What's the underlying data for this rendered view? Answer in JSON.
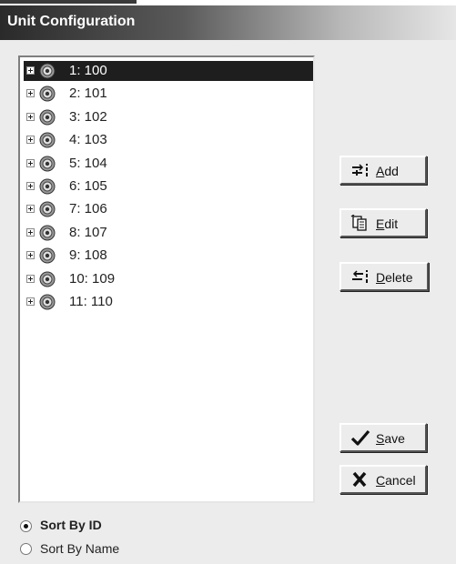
{
  "window": {
    "title": "Unit Configuration"
  },
  "tree": {
    "items": [
      {
        "label": "1: 100",
        "selected": true
      },
      {
        "label": "2: 101",
        "selected": false
      },
      {
        "label": "3: 102",
        "selected": false
      },
      {
        "label": "4: 103",
        "selected": false
      },
      {
        "label": "5: 104",
        "selected": false
      },
      {
        "label": "6: 105",
        "selected": false
      },
      {
        "label": "7: 106",
        "selected": false
      },
      {
        "label": "8: 107",
        "selected": false
      },
      {
        "label": "9: 108",
        "selected": false
      },
      {
        "label": "10: 109",
        "selected": false
      },
      {
        "label": "11: 110",
        "selected": false
      }
    ]
  },
  "buttons": {
    "add": {
      "pre": "",
      "accel": "A",
      "post": "dd",
      "icon": "add-icon"
    },
    "edit": {
      "pre": "",
      "accel": "E",
      "post": "dit",
      "icon": "edit-icon"
    },
    "delete": {
      "pre": "",
      "accel": "D",
      "post": "elete",
      "icon": "delete-icon"
    },
    "save": {
      "pre": "",
      "accel": "S",
      "post": "ave",
      "icon": "checkmark-icon"
    },
    "cancel": {
      "pre": "",
      "accel": "C",
      "post": "ancel",
      "icon": "x-icon"
    }
  },
  "sort": {
    "options": [
      {
        "label": "Sort By ID",
        "checked": true
      },
      {
        "label": "Sort By Name",
        "checked": false
      }
    ]
  },
  "colors": {
    "titlebar": "#2a2a2a",
    "selection": "#1e1e1e",
    "face": "#ececec"
  }
}
